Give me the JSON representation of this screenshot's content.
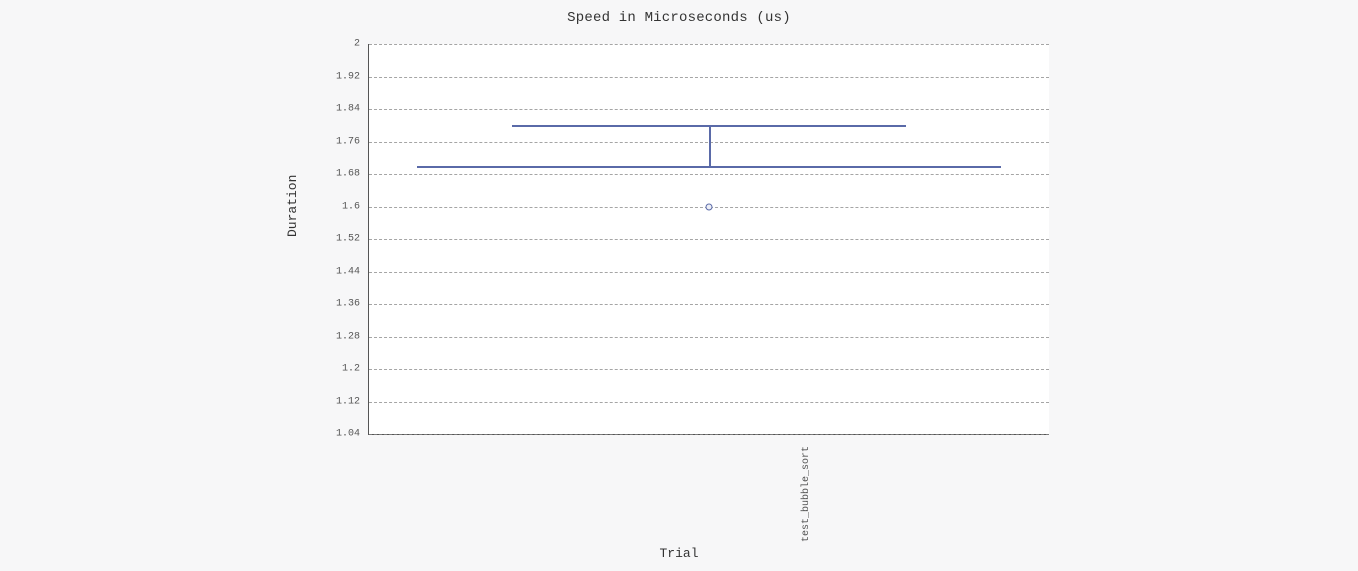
{
  "chart_data": {
    "type": "boxplot",
    "title": "Speed in Microseconds (us)",
    "xlabel": "Trial",
    "ylabel": "Duration",
    "ylim": [
      1.04,
      2.0
    ],
    "yticks": [
      2,
      1.92,
      1.84,
      1.76,
      1.68,
      1.6,
      1.52,
      1.44,
      1.36,
      1.28,
      1.2,
      1.12,
      1.04
    ],
    "categories": [
      "test_bubble_sort"
    ],
    "series": [
      {
        "name": "test_bubble_sort",
        "min_whisker": 1.7,
        "q1": 1.7,
        "median": 1.74,
        "q3": 1.8,
        "max_whisker": 1.8,
        "outliers": [
          1.6
        ],
        "whisker_low_span": [
          0.07,
          0.93
        ],
        "whisker_high_span": [
          0.21,
          0.79
        ]
      }
    ],
    "colors": {
      "box": "#5a6aa8",
      "grid": "#888888",
      "axis": "#555555",
      "bg": "#f7f7f8"
    }
  }
}
